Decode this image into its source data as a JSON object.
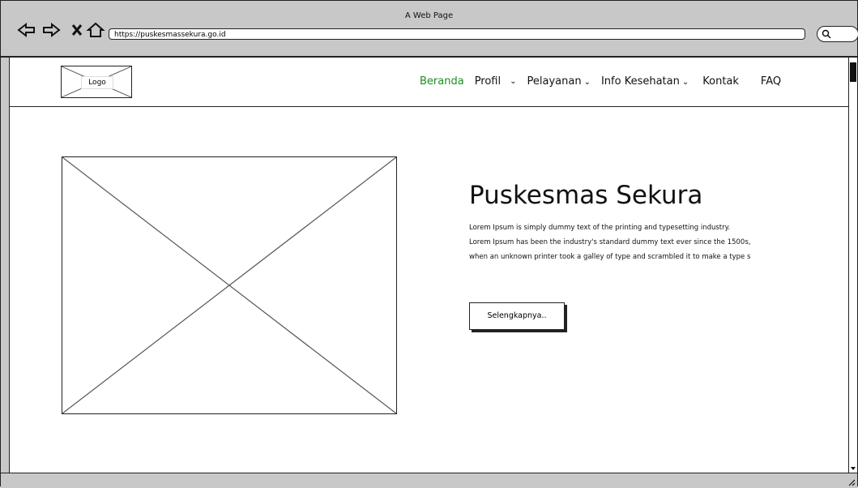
{
  "window": {
    "title": "A Web Page"
  },
  "browser": {
    "url": "https://puskesmassekura.go.id"
  },
  "header": {
    "logo_label": "Logo",
    "menu": [
      {
        "label": "Beranda",
        "active": true
      },
      {
        "label": "Profil",
        "dropdown": true
      },
      {
        "label": "Pelayanan",
        "dropdown": true
      },
      {
        "label": "Info Kesehatan",
        "dropdown": true
      },
      {
        "label": "Kontak"
      },
      {
        "label": "FAQ"
      }
    ]
  },
  "hero": {
    "title": "Puskesmas Sekura",
    "line1": "Lorem Ipsum is simply dummy text of the printing and typesetting industry.",
    "line2": "Lorem Ipsum has been the industry's standard dummy text ever since the 1500s,",
    "line3": "when an unknown printer took a galley of type and scrambled it to make a type s",
    "button": "Selengkapnya.."
  },
  "colors": {
    "active": "#1e8c1e"
  }
}
